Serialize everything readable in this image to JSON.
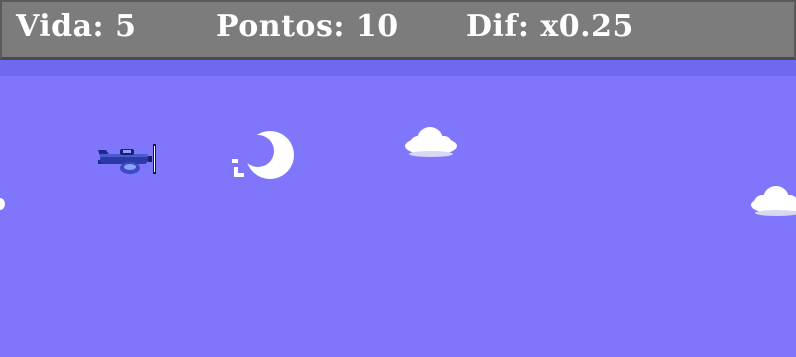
{
  "hud": {
    "life_label": "Vida:",
    "life_value": "5",
    "score_label": "Pontos:",
    "score_value": "10",
    "difficulty_label": "Dif:",
    "difficulty_value": "x0.25"
  },
  "colors": {
    "sky": "#7f76fb",
    "hud_background": "#7c7c7c",
    "hud_text": "#ffffff",
    "player_plane": "#1f2a8c",
    "cloud": "#ffffff"
  },
  "sprites": {
    "player": "airplane-icon",
    "enemy": "crescent-moon-icon",
    "obstacle": "cloud-icon"
  }
}
